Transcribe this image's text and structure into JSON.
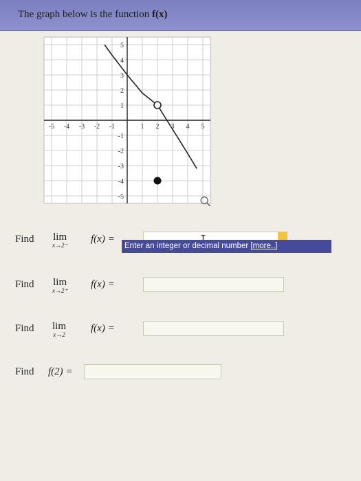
{
  "problem": {
    "prompt": "The graph below is the function",
    "function_label": "f(x)"
  },
  "graph": {
    "x_ticks": [
      "-5",
      "-4",
      "-3",
      "-2",
      "-1",
      "1",
      "2",
      "3",
      "4",
      "5"
    ],
    "y_ticks": [
      "5",
      "4",
      "3",
      "2",
      "1",
      "-1",
      "-2",
      "-3",
      "-4",
      "-5"
    ],
    "zoom_icon": "magnifier-icon",
    "curve": {
      "upper_segment": [
        [
          -1.5,
          5
        ],
        [
          -1,
          4.3
        ],
        [
          0,
          3.0
        ],
        [
          1,
          1.8
        ],
        [
          2,
          1
        ]
      ],
      "lower_segment": [
        [
          2,
          1
        ],
        [
          3,
          -0.6
        ],
        [
          4,
          -2.2
        ],
        [
          4.6,
          -3.2
        ]
      ],
      "open_point": [
        2,
        1
      ],
      "filled_point": [
        2,
        -4
      ]
    }
  },
  "questions": [
    {
      "find": "Find",
      "lim": "lim",
      "sub": "x→2⁻",
      "expr": "f(x) =",
      "value": ""
    },
    {
      "find": "Find",
      "lim": "lim",
      "sub": "x→2⁺",
      "expr": "f(x) =",
      "value": ""
    },
    {
      "find": "Find",
      "lim": "lim",
      "sub": "x→2",
      "expr": "f(x) =",
      "value": ""
    },
    {
      "find": "Find",
      "expr": "f(2) =",
      "value": ""
    }
  ],
  "hint": {
    "text": "Enter an integer or decimal number",
    "more": "[more..]"
  },
  "colors": {
    "banner": "#8386c6",
    "hint_bg": "#454a9a",
    "active_tab": "#f0c43c"
  }
}
